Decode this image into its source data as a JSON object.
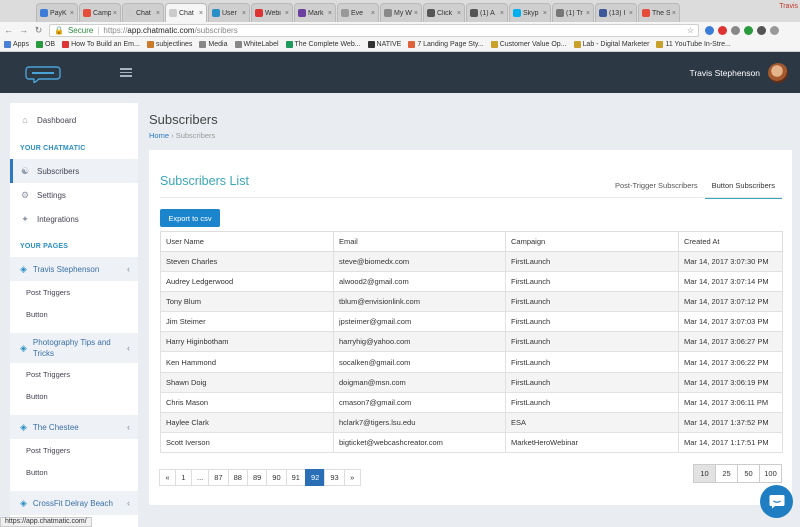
{
  "browser": {
    "tabs": [
      {
        "title": "PayK",
        "color": "#3b7dd8"
      },
      {
        "title": "Camp",
        "color": "#e44d3a"
      },
      {
        "title": "Chat",
        "color": "#cccccc"
      },
      {
        "title": "Chat",
        "color": "#cccccc",
        "active": true
      },
      {
        "title": "User",
        "color": "#2a8fc6"
      },
      {
        "title": "Webi",
        "color": "#d33"
      },
      {
        "title": "Mark",
        "color": "#6b3fa0"
      },
      {
        "title": "Eve",
        "color": "#999999"
      },
      {
        "title": "My W",
        "color": "#888888"
      },
      {
        "title": "Click",
        "color": "#555555"
      },
      {
        "title": "(1) A",
        "color": "#555555"
      },
      {
        "title": "Skyp",
        "color": "#00aff0"
      },
      {
        "title": "(1) Tr",
        "color": "#777777"
      },
      {
        "title": "(13) I",
        "color": "#3b5998"
      },
      {
        "title": "The S",
        "color": "#e44d3a"
      }
    ],
    "profile": "Travis",
    "secure_label": "Secure",
    "url_prefix": "https://",
    "url_host": "app.chatmatic.com",
    "url_path": "/subscribers",
    "bookmarks": [
      {
        "label": "Apps",
        "color": "#4a80d6"
      },
      {
        "label": "OB",
        "color": "#2a9a3e"
      },
      {
        "label": "How To Build an Em...",
        "color": "#d33"
      },
      {
        "label": "subjectlines",
        "color": "#c97a2a"
      },
      {
        "label": "Media",
        "color": "#888888"
      },
      {
        "label": "WhiteLabel",
        "color": "#888888"
      },
      {
        "label": "The Complete Web...",
        "color": "#1f9a5c"
      },
      {
        "label": "NATIVE",
        "color": "#333333"
      },
      {
        "label": "7 Landing Page Sty...",
        "color": "#e0623a"
      },
      {
        "label": "Customer Value Op...",
        "color": "#c9a02a"
      },
      {
        "label": "Lab - Digital Marketer",
        "color": "#c9a02a"
      },
      {
        "label": "11 YouTube In-Stre...",
        "color": "#c9a02a"
      }
    ],
    "status_url": "https://app.chatmatic.com/"
  },
  "header": {
    "user_name": "Travis Stephenson"
  },
  "sidebar": {
    "dashboard": "Dashboard",
    "section_chatmatic": "YOUR CHATMATIC",
    "items": [
      "Subscribers",
      "Settings",
      "Integrations"
    ],
    "section_pages": "YOUR PAGES",
    "pages": [
      {
        "name": "Travis Stephenson",
        "subs": [
          "Post Triggers",
          "Button"
        ]
      },
      {
        "name": "Photography Tips and Tricks",
        "subs": [
          "Post Triggers",
          "Button"
        ]
      },
      {
        "name": "The Chestee",
        "subs": [
          "Post Triggers",
          "Button"
        ]
      },
      {
        "name": "CrossFit Delray Beach",
        "subs": []
      }
    ]
  },
  "main": {
    "title": "Subscribers",
    "breadcrumb_home": "Home",
    "breadcrumb_current": "Subscribers",
    "card_title": "Subscribers List",
    "tabs": [
      "Post-Trigger Subscribers",
      "Button Subscribers"
    ],
    "active_tab": "Button Subscribers",
    "export_label": "Export to csv",
    "columns": [
      "User Name",
      "Email",
      "Campaign",
      "Created At"
    ],
    "rows": [
      [
        "Steven Charles",
        "steve@biomedx.com",
        "FirstLaunch",
        "Mar 14, 2017 3:07:30 PM"
      ],
      [
        "Audrey Ledgerwood",
        "alwood2@gmail.com",
        "FirstLaunch",
        "Mar 14, 2017 3:07:14 PM"
      ],
      [
        "Tony Blum",
        "tblum@envisionlink.com",
        "FirstLaunch",
        "Mar 14, 2017 3:07:12 PM"
      ],
      [
        "Jim Steimer",
        "jpsteimer@gmail.com",
        "FirstLaunch",
        "Mar 14, 2017 3:07:03 PM"
      ],
      [
        "Harry Higinbotham",
        "harryhig@yahoo.com",
        "FirstLaunch",
        "Mar 14, 2017 3:06:27 PM"
      ],
      [
        "Ken Hammond",
        "socalken@gmail.com",
        "FirstLaunch",
        "Mar 14, 2017 3:06:22 PM"
      ],
      [
        "Shawn Doig",
        "doigman@msn.com",
        "FirstLaunch",
        "Mar 14, 2017 3:06:19 PM"
      ],
      [
        "Chris Mason",
        "cmason7@gmail.com",
        "FirstLaunch",
        "Mar 14, 2017 3:06:11 PM"
      ],
      [
        "Haylee Clark",
        "hclark7@tigers.lsu.edu",
        "ESA",
        "Mar 14, 2017 1:37:52 PM"
      ],
      [
        "Scott Iverson",
        "bigticket@webcashcreator.com",
        "MarketHeroWebinar",
        "Mar 14, 2017 1:17:51 PM"
      ]
    ],
    "pagination": [
      "«",
      "1",
      "...",
      "87",
      "88",
      "89",
      "90",
      "91",
      "92",
      "93",
      "»"
    ],
    "current_page": "92",
    "page_sizes": [
      "10",
      "25",
      "50",
      "100"
    ],
    "selected_page_size": "10"
  },
  "colors": {
    "accent": "#1a84cc",
    "title_teal": "#3aa7b8",
    "header_bg": "#2d3845"
  }
}
